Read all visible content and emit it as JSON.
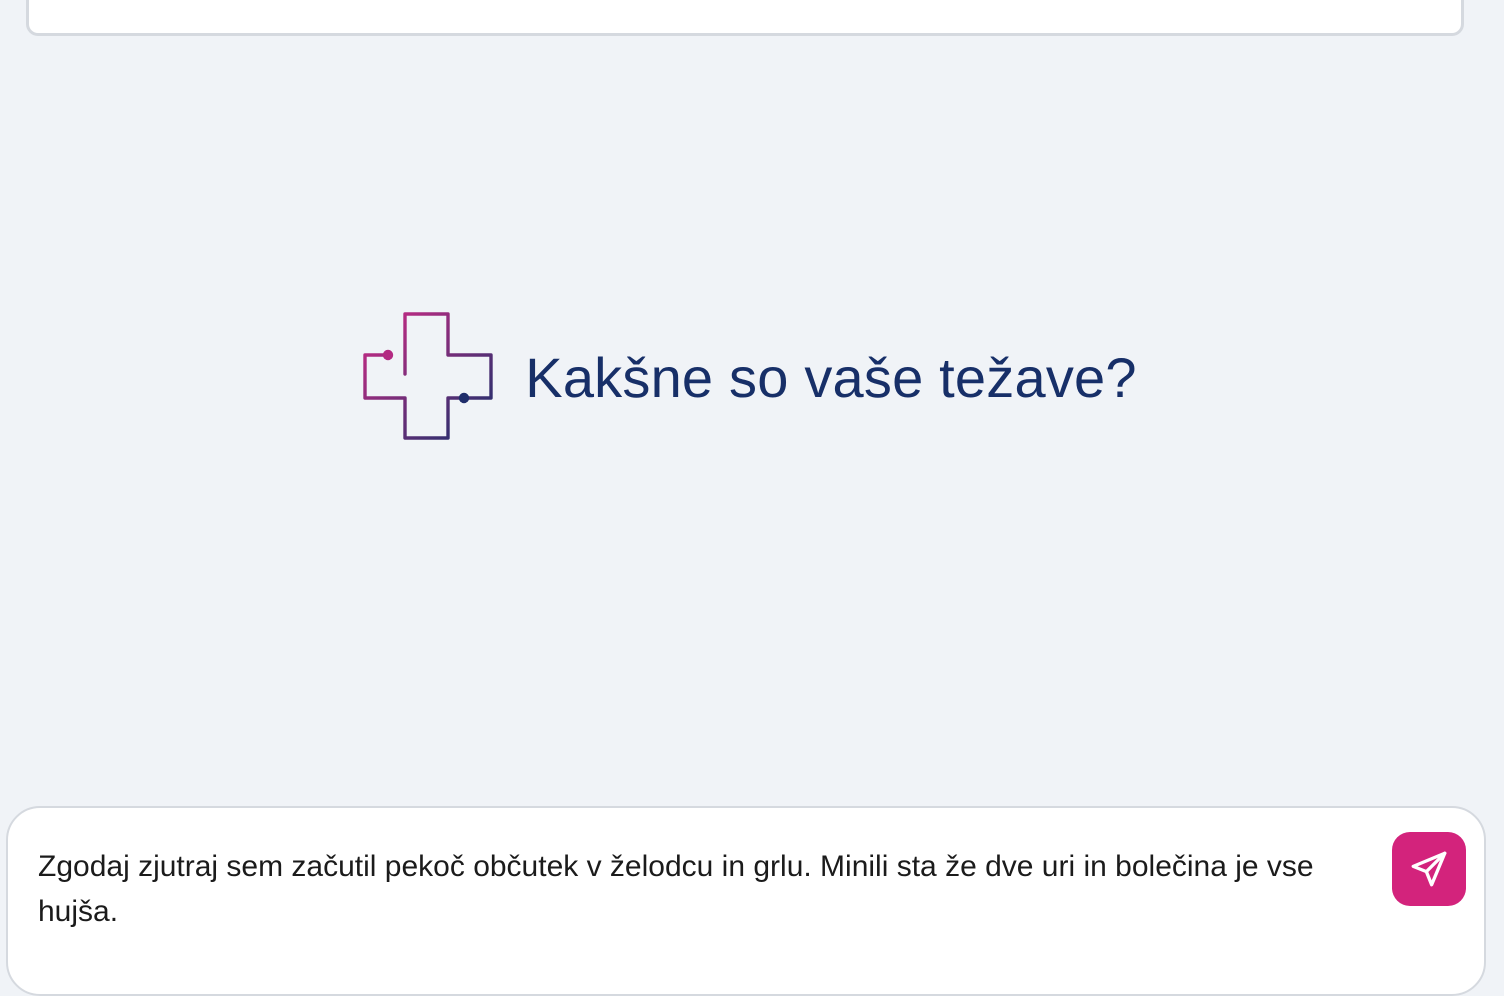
{
  "header": {
    "title": "Kakšne so vaše težave?"
  },
  "logo": {
    "icon": "medical-cross-logo",
    "gradient_start": "#c12a86",
    "gradient_end": "#1f2d6b"
  },
  "composer": {
    "value": "Zgodaj zjutraj sem začutil pekoč občutek v želodcu in grlu. Minili sta že dve uri in bolečina je vse hujša.",
    "send_icon": "paper-plane-icon",
    "send_color": "#d3237c"
  },
  "colors": {
    "background": "#f0f3f7",
    "title": "#172f68"
  }
}
